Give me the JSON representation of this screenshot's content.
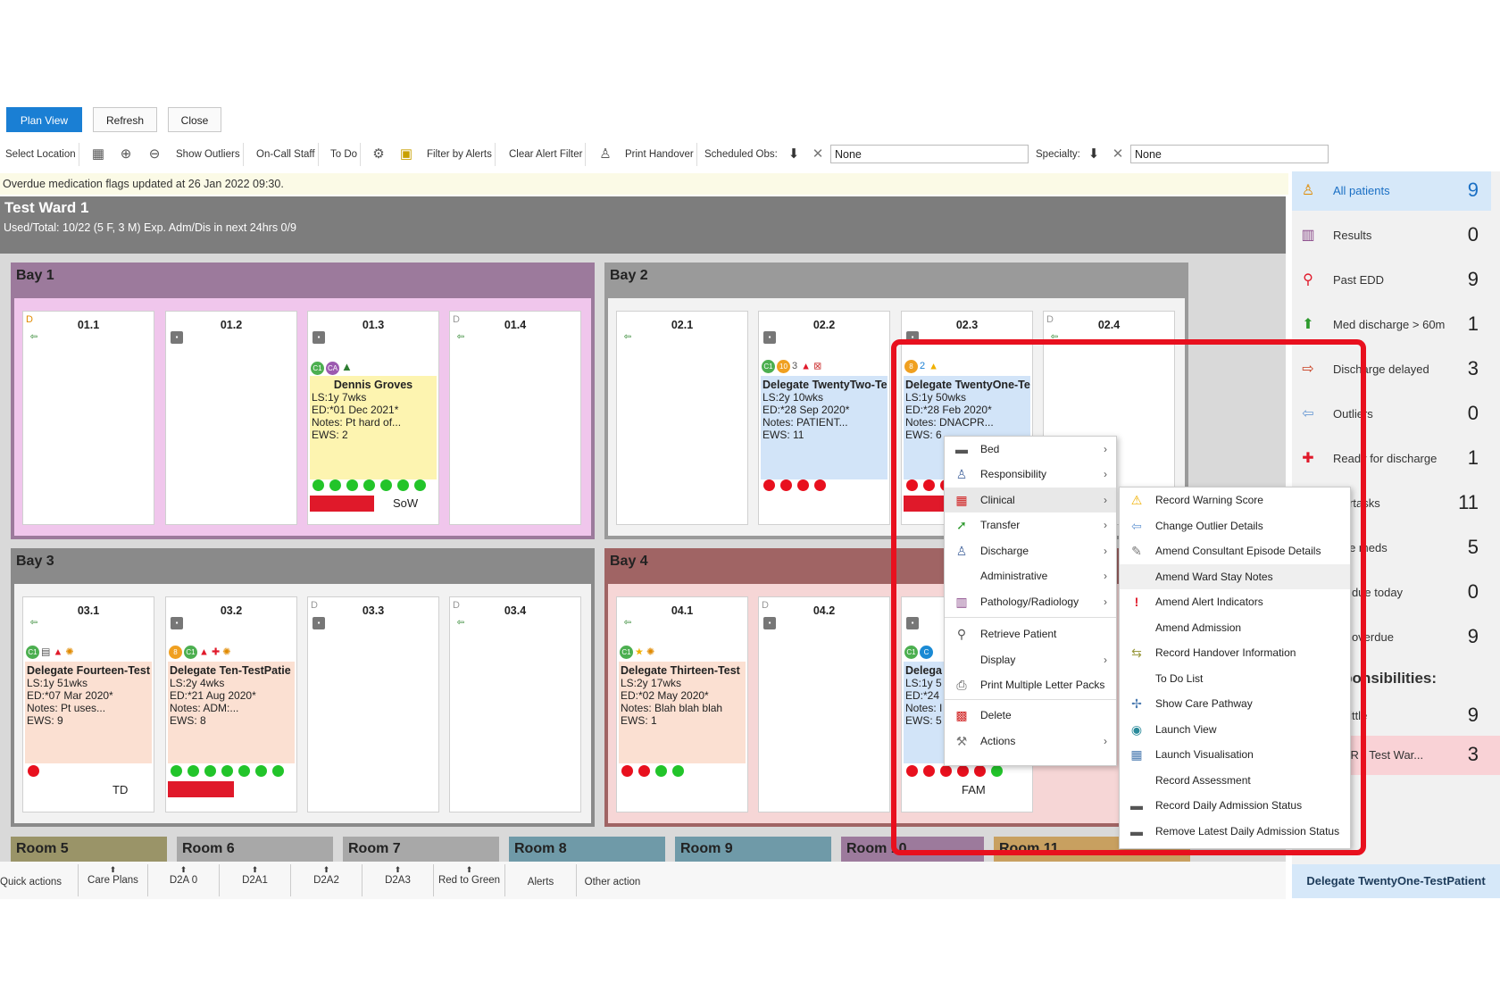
{
  "top_buttons": {
    "plan_view": "Plan View",
    "refresh": "Refresh",
    "close": "Close"
  },
  "toolbar": {
    "select_location": "Select Location",
    "show_outliers": "Show Outliers",
    "on_call_staff": "On-Call Staff",
    "to_do": "To Do",
    "filter_by_alerts": "Filter by Alerts",
    "clear_alert_filter": "Clear Alert Filter",
    "print_handover": "Print Handover",
    "scheduled_obs": "Scheduled Obs:",
    "scheduled_obs_value": "None",
    "specialty": "Specialty:",
    "specialty_value": "None"
  },
  "info_message": "Overdue medication flags updated at 26 Jan 2022 09:30.",
  "ward": {
    "title": "Test Ward 1",
    "subtitle": "Used/Total: 10/22 (5 F, 3 M) Exp. Adm/Dis in next 24hrs 0/9"
  },
  "bays": [
    {
      "name": "Bay 1",
      "color": "#9c7a9c"
    },
    {
      "name": "Bay 2",
      "color": "#9a9a9a"
    },
    {
      "name": "Bay 3",
      "color": "#8a8a8a"
    },
    {
      "name": "Bay 4",
      "color": "#a06464"
    }
  ],
  "beds": {
    "b011": {
      "num": "01.1",
      "d": "D"
    },
    "b012": {
      "num": "01.2"
    },
    "b013": {
      "num": "01.3",
      "name": "Dennis Groves",
      "ls": "LS:1y 7wks",
      "ed": "ED:*01 Dec 2021*",
      "notes": "Notes: Pt hard of...",
      "ews": "EWS: 2",
      "tag": "SoW",
      "badges": [
        "C1",
        "CA",
        "▲"
      ]
    },
    "b014": {
      "num": "01.4",
      "d": "D"
    },
    "b021": {
      "num": "02.1"
    },
    "b022": {
      "num": "02.2",
      "name": "Delegate TwentyTwo-Te",
      "ls": "LS:2y 10wks",
      "ed": "ED:*28 Sep 2020*",
      "notes": "Notes: PATIENT...",
      "ews": "EWS: 11",
      "badges": [
        "C1",
        "10",
        "3"
      ]
    },
    "b023": {
      "num": "02.3",
      "name": "Delegate TwentyOne-Te",
      "ls": "LS:1y 50wks",
      "ed": "ED:*28 Feb 2020*",
      "notes": "Notes: DNACPR...",
      "ews": "EWS: 6",
      "badges": [
        "8",
        "2"
      ]
    },
    "b024": {
      "num": "02.4",
      "d": "D"
    },
    "b031": {
      "num": "03.1",
      "name": "Delegate Fourteen-Test",
      "ls": "LS:1y 51wks",
      "ed": "ED:*07 Mar 2020*",
      "notes": "Notes: Pt uses...",
      "ews": "EWS: 9",
      "tag": "TD",
      "badges": [
        "C1"
      ]
    },
    "b032": {
      "num": "03.2",
      "name": "Delegate Ten-TestPatie",
      "ls": "LS:2y 4wks",
      "ed": "ED:*21 Aug 2020*",
      "notes": "Notes: ADM:...",
      "ews": "EWS: 8",
      "badges": [
        "8",
        "C1"
      ]
    },
    "b033": {
      "num": "03.3",
      "d": "D"
    },
    "b034": {
      "num": "03.4",
      "d": "D"
    },
    "b041": {
      "num": "04.1",
      "name": "Delegate Thirteen-Test",
      "ls": "LS:2y 17wks",
      "ed": "ED:*02 May 2020*",
      "notes": "Notes: Blah blah blah",
      "ews": "EWS: 1",
      "badges": [
        "C1"
      ]
    },
    "b042": {
      "num": "04.2",
      "d": "D"
    },
    "b043": {
      "name": "Delega",
      "ls": "LS:1y 5",
      "ed": "ED:*24",
      "notes": "Notes: I",
      "ews": "EWS: 5",
      "tag": "FAM",
      "badges": [
        "C1",
        "C"
      ]
    }
  },
  "rooms": [
    "Room 5",
    "Room 6",
    "Room 7",
    "Room 8",
    "Room 9",
    "Room 10",
    "Room 11"
  ],
  "quick_actions": {
    "label": "Quick actions",
    "items": [
      "Care Plans",
      "D2A 0",
      "D2A1",
      "D2A2",
      "D2A3",
      "Red to Green",
      "Alerts",
      "Other action"
    ]
  },
  "right_panel": [
    {
      "icon": "person-icon",
      "label": "All patients",
      "count": "9"
    },
    {
      "icon": "results-icon",
      "label": "Results",
      "count": "0"
    },
    {
      "icon": "edd-icon",
      "label": "Past EDD",
      "count": "9"
    },
    {
      "icon": "up-arrow-icon",
      "label": "Med discharge > 60m",
      "count": "1"
    },
    {
      "icon": "discharge-icon",
      "label": "Discharge delayed",
      "count": "3"
    },
    {
      "icon": "outlier-icon",
      "label": "Outliers",
      "count": "0"
    },
    {
      "icon": "ready-icon",
      "label": "Ready for discharge",
      "count": "1"
    },
    {
      "label": "...ertasks",
      "count": "11"
    },
    {
      "label": "...ue meds",
      "count": "5"
    },
    {
      "label": "...s due today",
      "count": "0"
    },
    {
      "label": "...s overdue",
      "count": "9"
    }
  ],
  "responsibilities": {
    "title": "...ponsibilities:",
    "rows": [
      {
        "label": "...Little",
        "count": "9"
      },
      {
        "label": "...PR - Test War...",
        "count": "3"
      }
    ]
  },
  "footer_patient": "Delegate TwentyOne-TestPatient",
  "context_menu": [
    "Bed",
    "Responsibility",
    "Clinical",
    "Transfer",
    "Discharge",
    "Administrative",
    "Pathology/Radiology",
    "Retrieve Patient",
    "Display",
    "Print Multiple Letter Packs",
    "Delete",
    "Actions"
  ],
  "submenu": [
    "Record Warning Score",
    "Change Outlier Details",
    "Amend Consultant Episode Details",
    "Amend Ward Stay Notes",
    "Amend Alert Indicators",
    "Amend Admission",
    "Record Handover Information",
    "To Do List",
    "Show Care Pathway",
    "Launch View",
    "Launch Visualisation",
    "Record Assessment",
    "Record Daily Admission Status",
    "Remove Latest Daily Admission Status"
  ]
}
